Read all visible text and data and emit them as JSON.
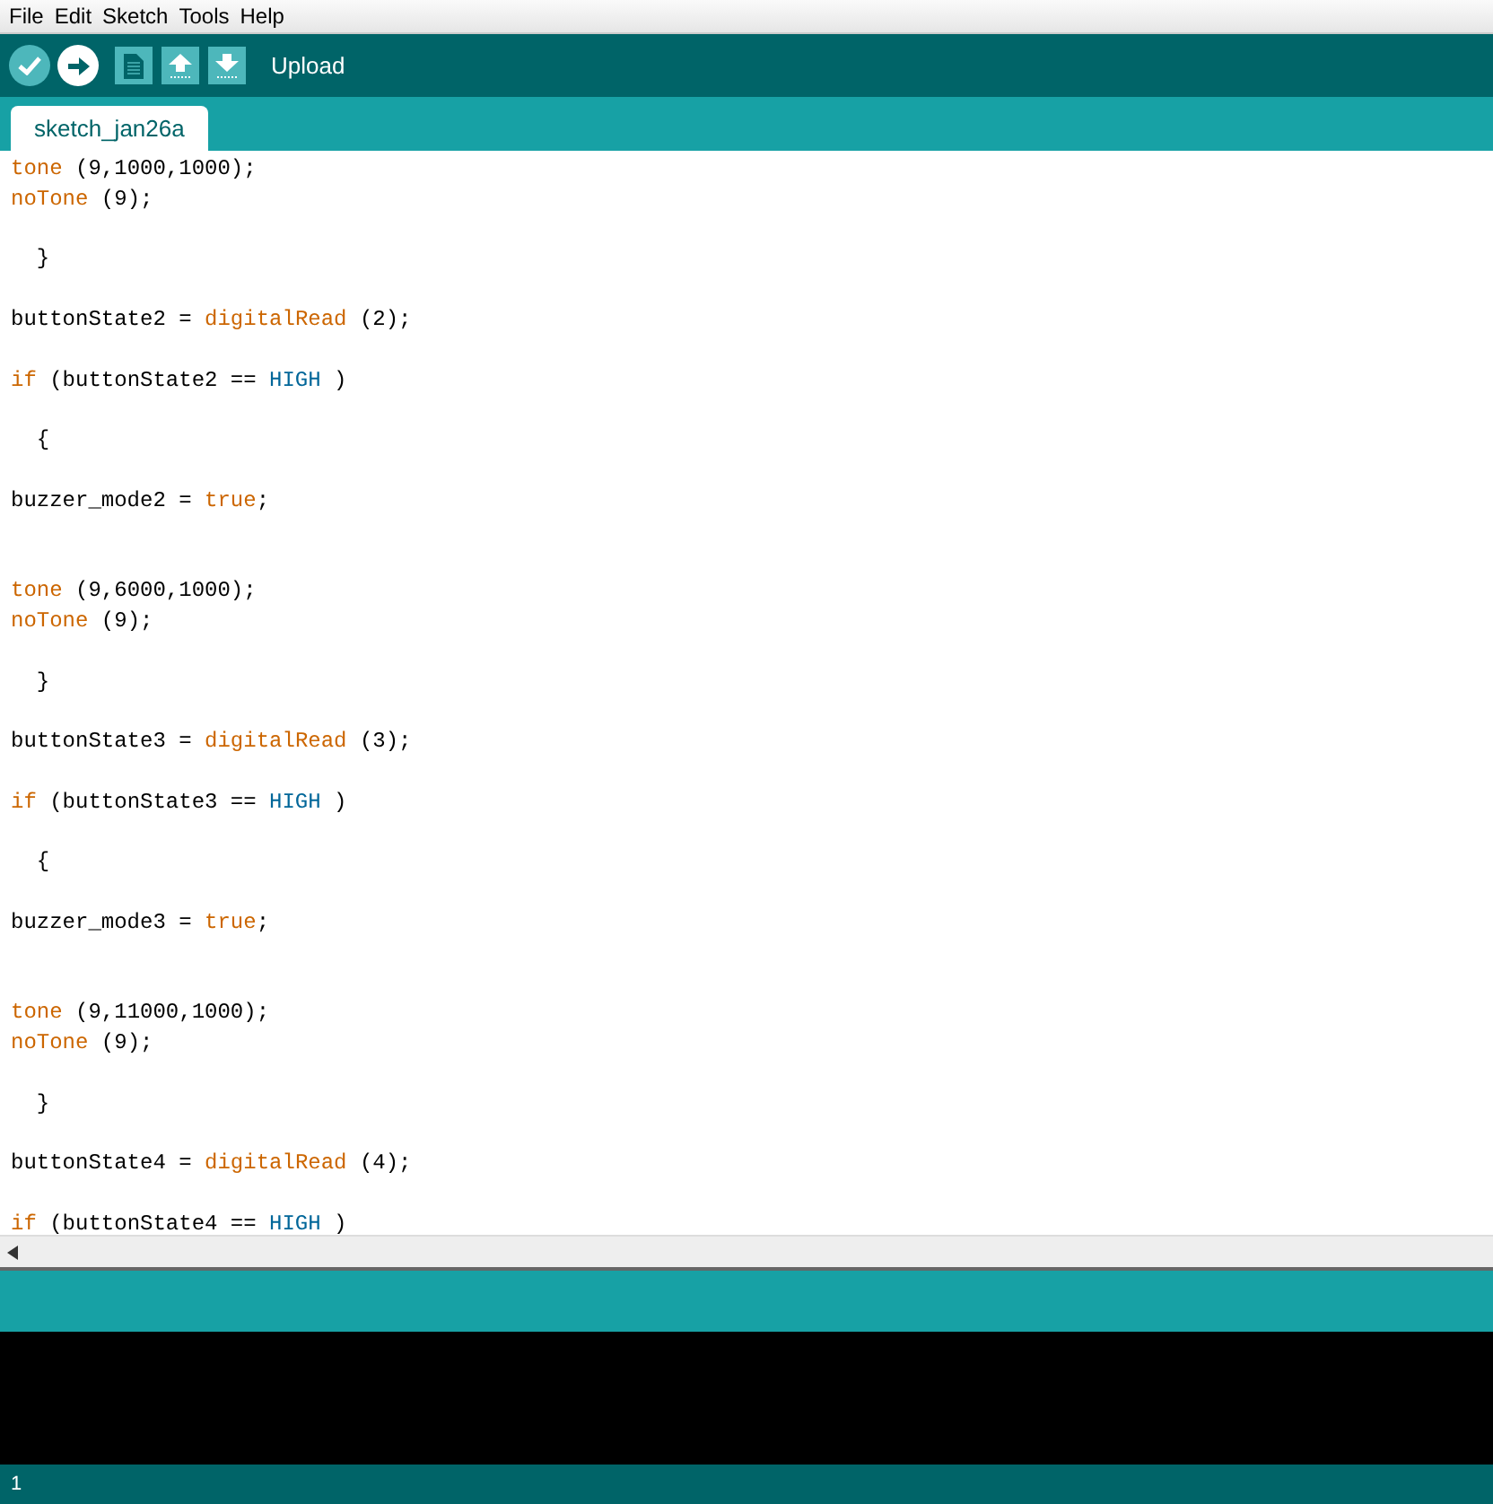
{
  "menu": [
    "File",
    "Edit",
    "Sketch",
    "Tools",
    "Help"
  ],
  "toolbar": {
    "buttons": [
      {
        "kind": "verify"
      },
      {
        "kind": "upload"
      },
      {
        "kind": "new"
      },
      {
        "kind": "open"
      },
      {
        "kind": "save"
      }
    ],
    "hint": "Upload"
  },
  "tabs": [
    {
      "label": "sketch_jan26a",
      "selected": true
    }
  ],
  "editor": {
    "lines": [
      {
        "kind": "code",
        "tokens": [
          {
            "text": "tone",
            "kind": "keyword"
          },
          {
            "text": " (9,1000,1000);",
            "kind": "plain"
          }
        ]
      },
      {
        "kind": "code",
        "tokens": [
          {
            "text": "noTone",
            "kind": "keyword"
          },
          {
            "text": " (9);",
            "kind": "plain"
          }
        ]
      },
      {
        "kind": "blank"
      },
      {
        "kind": "code",
        "tokens": [
          {
            "text": "  }",
            "kind": "plain"
          }
        ]
      },
      {
        "kind": "blank"
      },
      {
        "kind": "code",
        "tokens": [
          {
            "text": "buttonState2 = ",
            "kind": "plain"
          },
          {
            "text": "digitalRead",
            "kind": "keyword"
          },
          {
            "text": " (2);",
            "kind": "plain"
          }
        ]
      },
      {
        "kind": "blank"
      },
      {
        "kind": "code",
        "tokens": [
          {
            "text": "if",
            "kind": "keyword"
          },
          {
            "text": " (buttonState2 == ",
            "kind": "plain"
          },
          {
            "text": "HIGH",
            "kind": "constant"
          },
          {
            "text": " )",
            "kind": "plain"
          }
        ]
      },
      {
        "kind": "blank"
      },
      {
        "kind": "code",
        "tokens": [
          {
            "text": "  {",
            "kind": "plain"
          }
        ]
      },
      {
        "kind": "blank"
      },
      {
        "kind": "code",
        "tokens": [
          {
            "text": "buzzer_mode2 = ",
            "kind": "plain"
          },
          {
            "text": "true",
            "kind": "keyword"
          },
          {
            "text": ";",
            "kind": "plain"
          }
        ]
      },
      {
        "kind": "blank"
      },
      {
        "kind": "blank"
      },
      {
        "kind": "code",
        "tokens": [
          {
            "text": "tone",
            "kind": "keyword"
          },
          {
            "text": " (9,6000,1000);",
            "kind": "plain"
          }
        ]
      },
      {
        "kind": "code",
        "tokens": [
          {
            "text": "noTone",
            "kind": "keyword"
          },
          {
            "text": " (9);",
            "kind": "plain"
          }
        ]
      },
      {
        "kind": "blank"
      },
      {
        "kind": "code",
        "tokens": [
          {
            "text": "  }",
            "kind": "plain"
          }
        ]
      },
      {
        "kind": "blank"
      },
      {
        "kind": "code",
        "tokens": [
          {
            "text": "buttonState3 = ",
            "kind": "plain"
          },
          {
            "text": "digitalRead",
            "kind": "keyword"
          },
          {
            "text": " (3);",
            "kind": "plain"
          }
        ]
      },
      {
        "kind": "blank"
      },
      {
        "kind": "code",
        "tokens": [
          {
            "text": "if",
            "kind": "keyword"
          },
          {
            "text": " (buttonState3 == ",
            "kind": "plain"
          },
          {
            "text": "HIGH",
            "kind": "constant"
          },
          {
            "text": " )",
            "kind": "plain"
          }
        ]
      },
      {
        "kind": "blank"
      },
      {
        "kind": "code",
        "tokens": [
          {
            "text": "  {",
            "kind": "plain"
          }
        ]
      },
      {
        "kind": "blank"
      },
      {
        "kind": "code",
        "tokens": [
          {
            "text": "buzzer_mode3 = ",
            "kind": "plain"
          },
          {
            "text": "true",
            "kind": "keyword"
          },
          {
            "text": ";",
            "kind": "plain"
          }
        ]
      },
      {
        "kind": "blank"
      },
      {
        "kind": "blank"
      },
      {
        "kind": "code",
        "tokens": [
          {
            "text": "tone",
            "kind": "keyword"
          },
          {
            "text": " (9,11000,1000);",
            "kind": "plain"
          }
        ]
      },
      {
        "kind": "code",
        "tokens": [
          {
            "text": "noTone",
            "kind": "keyword"
          },
          {
            "text": " (9);",
            "kind": "plain"
          }
        ]
      },
      {
        "kind": "blank"
      },
      {
        "kind": "code",
        "tokens": [
          {
            "text": "  }",
            "kind": "plain"
          }
        ]
      },
      {
        "kind": "blank"
      },
      {
        "kind": "code",
        "tokens": [
          {
            "text": "buttonState4 = ",
            "kind": "plain"
          },
          {
            "text": "digitalRead",
            "kind": "keyword"
          },
          {
            "text": " (4);",
            "kind": "plain"
          }
        ]
      },
      {
        "kind": "blank"
      },
      {
        "kind": "code",
        "tokens": [
          {
            "text": "if",
            "kind": "keyword"
          },
          {
            "text": " (buttonState4 == ",
            "kind": "plain"
          },
          {
            "text": "HIGH",
            "kind": "constant"
          },
          {
            "text": " )",
            "kind": "plain"
          }
        ]
      }
    ]
  },
  "status_bar": {
    "line": "1"
  }
}
